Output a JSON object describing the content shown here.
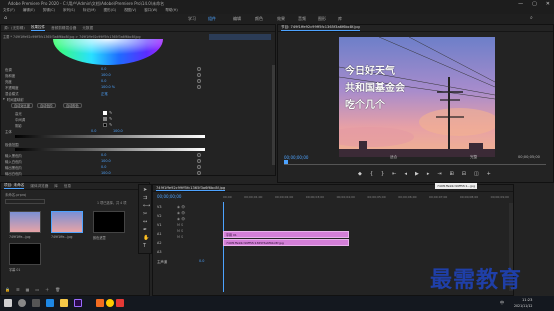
{
  "window": {
    "title": "Adobe Premiere Pro 2020 - C:\\用户\\Admin\\文档\\Adobe\\Premiere Pro\\14.0\\未命名",
    "controls": [
      "—",
      "▢",
      "✕"
    ]
  },
  "menu": [
    "文件(F)",
    "编辑(E)",
    "剪辑(C)",
    "序列(S)",
    "标记(M)",
    "图形(G)",
    "视图(V)",
    "窗口(W)",
    "帮助(H)"
  ],
  "workspaces": [
    "学习",
    "组件",
    "编辑",
    "颜色",
    "效果",
    "音频",
    "图形",
    "库"
  ],
  "active_workspace_index": 1,
  "effect_controls": {
    "tabs": [
      "源：(无剪辑)",
      "效果控件",
      "音频剪辑混合器",
      "元数据"
    ],
    "active_tab_index": 1,
    "breadcrumb": "主要 * 749f1ffe92c99ff5fc1365f3a6f6bc8f.jpg  >  749f1ffe92c99ff5fc1365f3a6f6bc8f.jpg",
    "rows": [
      {
        "label": "色调",
        "value": "0.0",
        "group": false
      },
      {
        "label": "饱和度",
        "value": "100.0",
        "group": false
      },
      {
        "label": "亮度",
        "value": "0.0",
        "group": false
      },
      {
        "label": "不透明度",
        "value": "100.0 %",
        "group": false
      },
      {
        "label": "混合模式",
        "value": "正常",
        "group": false
      },
      {
        "label": "时间重映射",
        "value": "",
        "group": true
      },
      {
        "label": "高光",
        "value": "",
        "group": false
      },
      {
        "label": "中间调",
        "value": "",
        "group": false
      },
      {
        "label": "阴影",
        "value": "",
        "group": false
      },
      {
        "label": "主体",
        "value": "",
        "group": false
      },
      {
        "label": "输入黑色阶",
        "value": "0.0",
        "group": false
      },
      {
        "label": "输入白色阶",
        "value": "100.0",
        "group": false
      },
      {
        "label": "输出黑色阶",
        "value": "0.0",
        "group": false
      },
      {
        "label": "输出白色阶",
        "value": "100.0",
        "group": false
      },
      {
        "label": "灰度系数",
        "value": "1.00",
        "group": false
      }
    ],
    "buttons": [
      "自动对比度",
      "自动色阶",
      "自动颜色"
    ],
    "range_label": "极值范围",
    "range_values": [
      "0.0",
      "100.0"
    ]
  },
  "program_monitor": {
    "title": "节目: 749f1ffe92c99ff5fc1365f3a6f6bc8f.jpg",
    "caption_lines": [
      "今日好天气",
      "共和国基金会",
      "吃个几个"
    ],
    "timecode_left": "00;00;00;00",
    "fit": "适合",
    "quality": "完整",
    "timecode_right": "00;00;05;00",
    "transport_icons": [
      "marker-icon",
      "in-point-icon",
      "out-point-icon",
      "go-in-icon",
      "step-back-icon",
      "play-icon",
      "step-forward-icon",
      "go-out-icon",
      "insert-icon",
      "overwrite-icon",
      "export-frame-icon",
      "button-editor-icon"
    ]
  },
  "project": {
    "tabs": [
      "项目: 未命名",
      "媒体浏览器",
      "库",
      "信息"
    ],
    "active_tab_index": 0,
    "file_name": "未命名.prproj",
    "item_count": "1 项已选择，共 4 项",
    "search_placeholder": "",
    "items": [
      {
        "name": "749f1ffe...jpg",
        "duration": "5;00"
      },
      {
        "name": "749f1ffe...jpg",
        "duration": "5;00"
      },
      {
        "name": "颜色遮罩",
        "duration": "5;00"
      },
      {
        "name": "字幕 01",
        "duration": "5;00"
      }
    ]
  },
  "timeline": {
    "tab": "749f1ffe92c99ff5fc1365f3a6f6bc8f.jpg",
    "timecode": "00;00;00;00",
    "ruler": [
      "00;00",
      "00;00;01;00",
      "00;00;02;00",
      "00;00;03;00",
      "00;00;04;00",
      "00;00;05;00",
      "00;00;06;00",
      "00;00;07;00",
      "00;00;08;00",
      "00;00;09;00"
    ],
    "tracks": [
      "V3",
      "V2",
      "V1",
      "A1",
      "A2",
      "A3",
      "主声道"
    ],
    "master_value": "0.0",
    "clips": [
      {
        "label": "字幕 01",
        "track": 1
      },
      {
        "label": "749f1ffe92c99ff5fc1365f3a6f6bc8f.jpg",
        "track": 2
      }
    ],
    "tooltip": "749f1ffe92c99ff5fc1...jpg"
  },
  "taskbar": {
    "time": "11:23",
    "date": "2021/11/12",
    "ime": "中"
  },
  "watermark": "最需教育",
  "colors": {
    "accent": "#4da3ff",
    "clip": "#d47fd8",
    "panel": "#232323"
  }
}
